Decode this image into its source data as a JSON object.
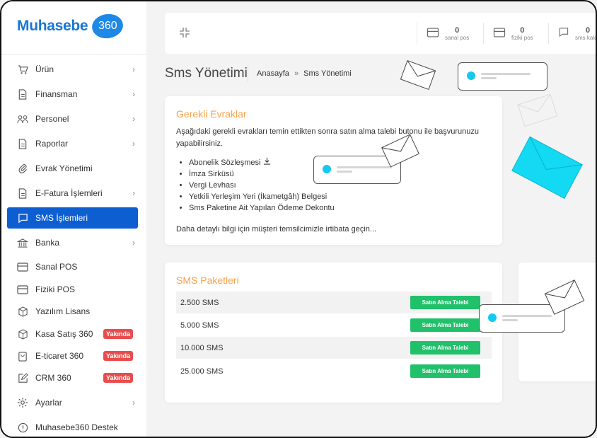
{
  "brand": {
    "name": "Muhasebe",
    "badge": "360",
    "color": "#1976d2"
  },
  "sidebar": {
    "items": [
      {
        "label": "Ürün",
        "icon": "cart-icon",
        "chevron": true
      },
      {
        "label": "Finansman",
        "icon": "document-icon",
        "chevron": true
      },
      {
        "label": "Personel",
        "icon": "people-icon",
        "chevron": true
      },
      {
        "label": "Raporlar",
        "icon": "document-icon",
        "chevron": true
      },
      {
        "label": "Evrak Yönetimi",
        "icon": "paperclip-icon",
        "chevron": false
      },
      {
        "label": "E-Fatura İşlemleri",
        "icon": "document-icon",
        "chevron": true
      },
      {
        "label": "SMS İşlemleri",
        "icon": "message-icon",
        "chevron": false,
        "active": true
      },
      {
        "label": "Banka",
        "icon": "bank-icon",
        "chevron": true
      },
      {
        "label": "Sanal POS",
        "icon": "card-icon",
        "chevron": false
      },
      {
        "label": "Fiziki POS",
        "icon": "card-icon",
        "chevron": false
      },
      {
        "label": "Yazılım Lisans",
        "icon": "box-icon",
        "chevron": false
      },
      {
        "label": "Kasa Satış 360",
        "icon": "box-icon",
        "chevron": false,
        "badge": "Yakında"
      },
      {
        "label": "E-ticaret 360",
        "icon": "bag-icon",
        "chevron": false,
        "badge": "Yakında"
      },
      {
        "label": "CRM 360",
        "icon": "edit-icon",
        "chevron": false,
        "badge": "Yakında"
      },
      {
        "label": "Ayarlar",
        "icon": "gear-icon",
        "chevron": true
      },
      {
        "label": "Muhasebe360 Destek",
        "icon": "info-icon",
        "chevron": false
      }
    ]
  },
  "topbar": {
    "stats": [
      {
        "value": "0",
        "label": "sanal pos",
        "icon": "card-icon"
      },
      {
        "value": "0",
        "label": "fiziki pos",
        "icon": "card-icon"
      },
      {
        "value": "0",
        "label": "sms kalan",
        "icon": "message-icon"
      }
    ]
  },
  "page": {
    "title": "Sms Yönetimi",
    "breadcrumb": {
      "home": "Anasayfa",
      "separator": "»",
      "current": "Sms Yönetimi"
    }
  },
  "documents": {
    "title": "Gerekli Evraklar",
    "description": "Aşağıdaki gerekli evrakları temin ettikten sonra satın alma talebi butonu ile başvurunuzu yapabilirsiniz.",
    "items": [
      "Abonelik Sözleşmesi",
      "İmza Sirküsü",
      "Vergi Levhası",
      "Yetkili Yerleşim Yeri (İkametgâh) Belgesi",
      "Sms Paketine Ait Yapılan Ödeme Dekontu"
    ],
    "footer": "Daha detaylı bilgi için müşteri temsilcimizle irtibata geçin..."
  },
  "packages": {
    "title": "SMS Paketleri",
    "rows": [
      {
        "name": "2.500 SMS",
        "button": "Satın Alma Talebi"
      },
      {
        "name": "5.000 SMS",
        "button": "Satın Alma Talebi"
      },
      {
        "name": "10.000 SMS",
        "button": "Satın Alma Talebi"
      },
      {
        "name": "25.000 SMS",
        "button": "Satın Alma Talebi"
      }
    ]
  },
  "colors": {
    "accent": "#f7a24a",
    "active": "#0d5fd1",
    "button": "#21c06b",
    "badge": "#e84d4d",
    "cyan": "#14c9ee"
  }
}
